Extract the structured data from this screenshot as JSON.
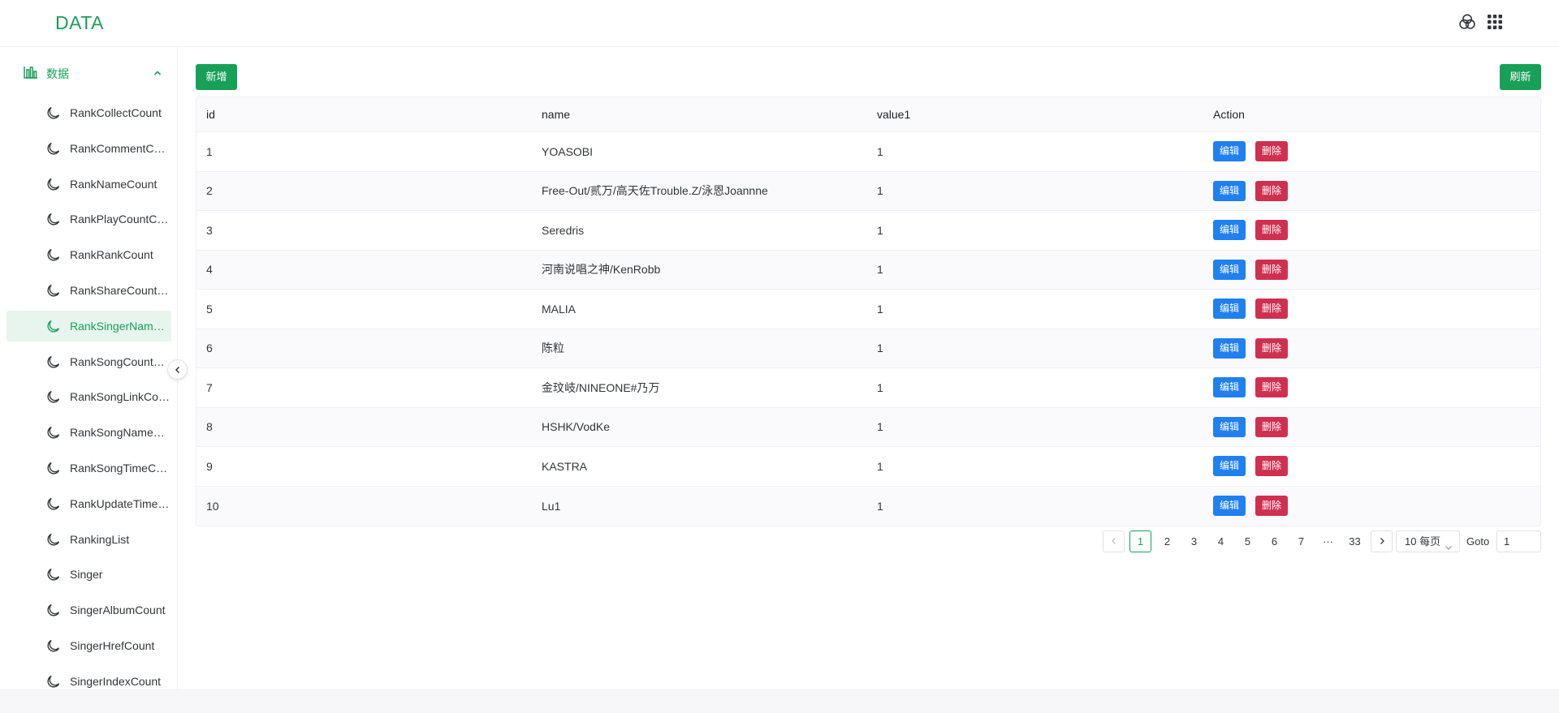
{
  "header": {
    "logo": "DATA",
    "icons": [
      "color-circles-icon",
      "apps-grid-icon"
    ]
  },
  "sidebar": {
    "group_label": "数据",
    "group_icon": "bar-chart-icon",
    "active_index": 6,
    "items": [
      {
        "label": "RankCollectCount"
      },
      {
        "label": "RankCommentCount"
      },
      {
        "label": "RankNameCount"
      },
      {
        "label": "RankPlayCountCount"
      },
      {
        "label": "RankRankCount"
      },
      {
        "label": "RankShareCountCount"
      },
      {
        "label": "RankSingerNameCount"
      },
      {
        "label": "RankSongCountCount"
      },
      {
        "label": "RankSongLinkCount"
      },
      {
        "label": "RankSongNameCount"
      },
      {
        "label": "RankSongTimeCount"
      },
      {
        "label": "RankUpdateTimeCount"
      },
      {
        "label": "RankingList"
      },
      {
        "label": "Singer"
      },
      {
        "label": "SingerAlbumCount"
      },
      {
        "label": "SingerHrefCount"
      },
      {
        "label": "SingerIndexCount"
      }
    ]
  },
  "toolbar": {
    "add_label": "新增",
    "refresh_label": "刷新"
  },
  "table": {
    "columns": [
      "id",
      "name",
      "value1",
      "Action"
    ],
    "edit_label": "编辑",
    "delete_label": "删除",
    "rows": [
      {
        "id": "1",
        "name": "YOASOBI",
        "value1": "1"
      },
      {
        "id": "2",
        "name": "Free-Out/贰万/高天佐Trouble.Z/泳恩Joannne",
        "value1": "1"
      },
      {
        "id": "3",
        "name": "Seredris",
        "value1": "1"
      },
      {
        "id": "4",
        "name": "河南说唱之神/KenRobb",
        "value1": "1"
      },
      {
        "id": "5",
        "name": "MALIA",
        "value1": "1"
      },
      {
        "id": "6",
        "name": "陈粒",
        "value1": "1"
      },
      {
        "id": "7",
        "name": "金玟岐/NINEONE#乃万",
        "value1": "1"
      },
      {
        "id": "8",
        "name": "HSHK/VodKe",
        "value1": "1"
      },
      {
        "id": "9",
        "name": "KASTRA",
        "value1": "1"
      },
      {
        "id": "10",
        "name": "Lu1",
        "value1": "1"
      }
    ]
  },
  "pagination": {
    "current_page": "1",
    "pages": [
      "1",
      "2",
      "3",
      "4",
      "5",
      "6",
      "7"
    ],
    "ellipsis": "···",
    "last_page": "33",
    "page_size_label": "10 每页",
    "goto_label": "Goto",
    "goto_value": "1"
  },
  "colors": {
    "primary": "#18a058",
    "info": "#2080f0",
    "error": "#d03050"
  }
}
